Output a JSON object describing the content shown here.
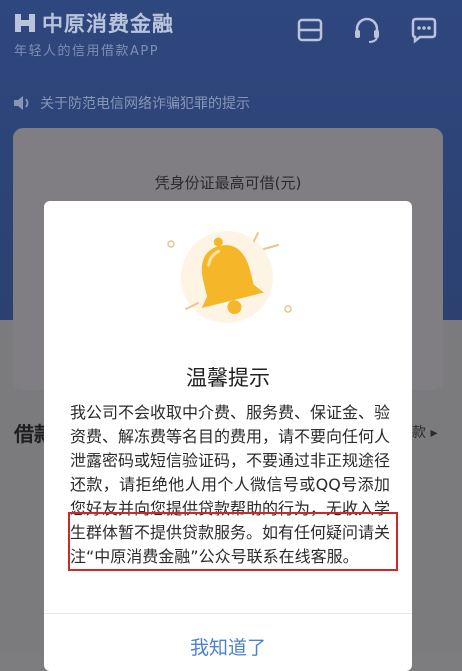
{
  "header": {
    "brand": "中原消费金融",
    "slogan": "年轻人的信用借款APP",
    "icons": [
      "card-icon",
      "headset-icon",
      "chat-bubble-icon"
    ]
  },
  "notice": {
    "text": "关于防范电信网络诈骗犯罪的提示"
  },
  "card": {
    "label": "凭身份证最高可借(元)"
  },
  "background": {
    "left_label": "借款",
    "right_label": "款 ▸"
  },
  "modal": {
    "title": "温馨提示",
    "body": "我公司不会收取中介费、服务费、保证金、验资费、解冻费等名目的费用，请不要向任何人泄露密码或短信验证码，不要通过非正规途径还款，请拒绝他人用个人微信号或QQ号添加您好友并向您提供贷款帮助的行为，无收入学生群体暂不提供贷款服务。如有任何疑问请关注“中原消费金融”公众号联系在线客服。",
    "confirm_label": "我知道了"
  },
  "colors": {
    "header_bg": "#2e477e",
    "overlay_bg": "#7b7b7e",
    "highlight_border": "#cc2a2a",
    "link": "#4c82d3",
    "bell": "#f5b62a"
  }
}
